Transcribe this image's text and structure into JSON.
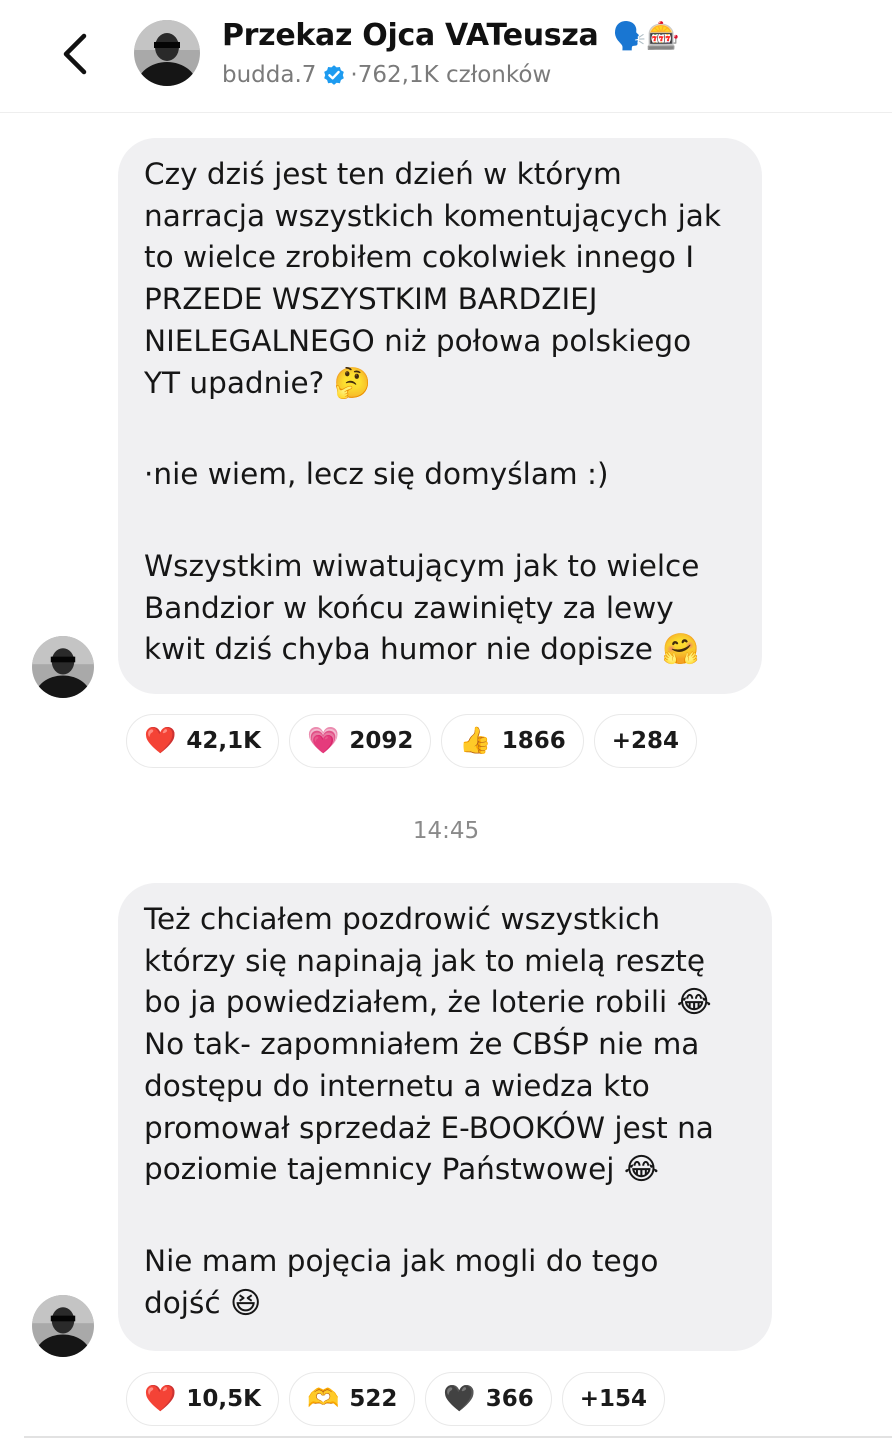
{
  "header": {
    "title": "Przekaz Ojca VATeusza",
    "title_emoji": "🗣️🎰",
    "username": "budda.7",
    "member_info": "·762,1K członków"
  },
  "icons": {
    "back": "chevron-left-icon",
    "verified": "verified-badge-icon",
    "avatar": "avatar"
  },
  "colors": {
    "bubble_bg": "#f0f0f2",
    "verified_blue": "#1d9bf0",
    "muted_text": "#7a7a7a"
  },
  "messages": [
    {
      "lines_1": [
        "Czy dziś jest ten dzień w którym",
        "narracja wszystkich komentujących jak",
        "to wielce zrobiłem cokolwiek innego I",
        "PRZEDE WSZYSTKIM BARDZIEJ",
        "NIELEGALNEGO niż połowa polskiego",
        "YT upadnie?"
      ],
      "emoji_1": "🤔",
      "line_2": "·nie wiem, lecz się domyślam :)",
      "lines_3": [
        "Wszystkim wiwatującym jak to wielce",
        "Bandzior w końcu zawinięty za lewy",
        "kwit dziś chyba humor nie dopisze"
      ],
      "emoji_3": "🤗",
      "reactions": [
        {
          "emoji": "❤️",
          "count": "42,1K"
        },
        {
          "emoji": "💗",
          "count": "2092"
        },
        {
          "emoji": "👍",
          "count": "1866"
        },
        {
          "emoji": "",
          "count": "+284"
        }
      ]
    },
    {
      "time": "14:45",
      "lines_1": [
        "Też chciałem pozdrowić wszystkich",
        "którzy się napinają jak to mielą resztę",
        "bo ja powiedziałem, że loterie robili",
        "No tak- zapomniałem że CBŚP nie ma",
        "dostępu do internetu a wiedza kto",
        "promował sprzedaż E-BOOKÓW jest na",
        "poziomie tajemnicy Państwowej"
      ],
      "emoji_a": "😂",
      "emoji_b": "😂",
      "lines_2": [
        "Nie mam pojęcia jak mogli do tego",
        "dojść"
      ],
      "emoji_2": "😆",
      "reactions": [
        {
          "emoji": "❤️",
          "count": "10,5K"
        },
        {
          "emoji": "🫶",
          "count": "522"
        },
        {
          "emoji": "🖤",
          "count": "366"
        },
        {
          "emoji": "",
          "count": "+154"
        }
      ]
    }
  ]
}
